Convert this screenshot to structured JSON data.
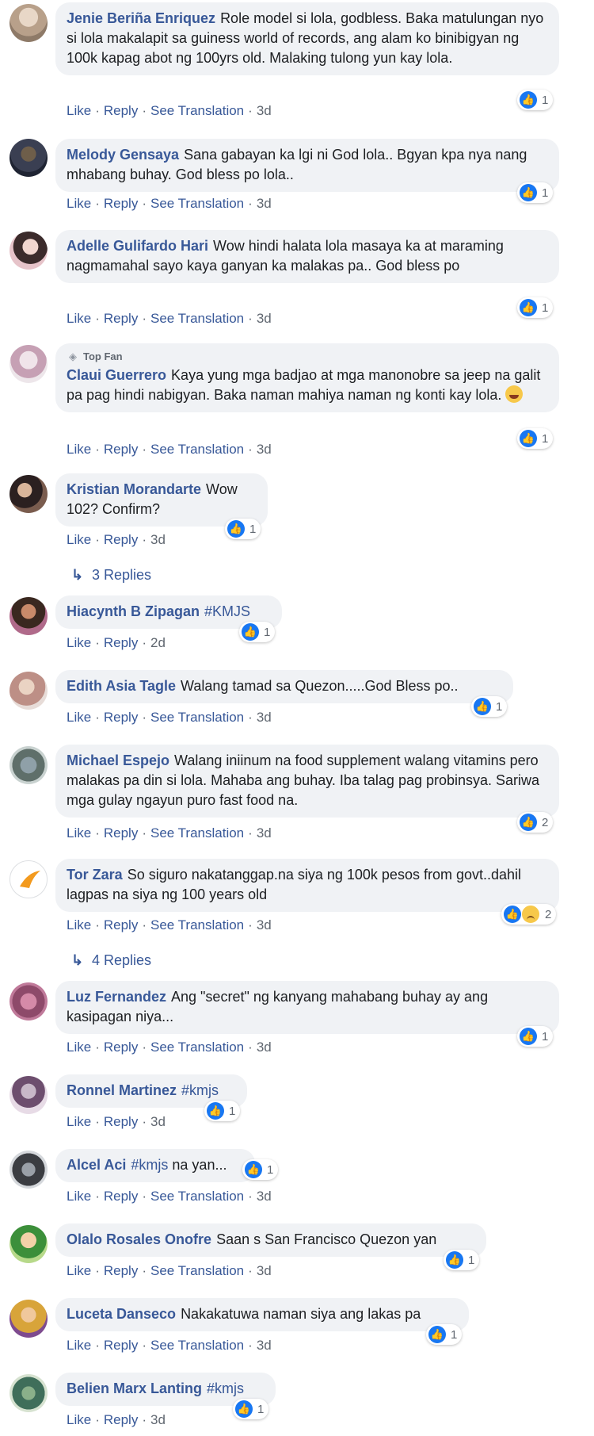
{
  "colors": {
    "name": "#385898",
    "bubble": "#f0f2f5",
    "like_blue": "#1877f2",
    "meta": "#606770"
  },
  "actions": {
    "like": "Like",
    "reply": "Reply",
    "translate": "See Translation",
    "sep": "·"
  },
  "badges": {
    "top_fan": "Top Fan"
  },
  "comments": [
    {
      "name": "Jenie Beriña Enriquez",
      "text": "Role model si lola, godbless. Baka matulungan nyo si lola makalapit sa guiness world of records, ang alam ko binibigyan ng 100k kapag abot ng 100yrs old. Malaking tulong yun kay lola.",
      "time": "3d",
      "reactions": "1"
    },
    {
      "name": "Melody Gensaya",
      "text": "Sana gabayan ka lgi ni God lola.. Bgyan kpa nya nang mhabang buhay. God bless po lola..",
      "time": "3d",
      "reactions": "1"
    },
    {
      "name": "Adelle Gulifardo Hari",
      "text": "Wow hindi halata lola masaya ka at maraming nagmamahal sayo kaya ganyan ka malakas pa.. God bless po",
      "time": "3d",
      "reactions": "1"
    },
    {
      "name": "Claui Guerrero",
      "text": "Kaya yung mga badjao at mga manonobre sa jeep na galit pa pag hindi nabigyan. Baka naman mahiya naman ng konti kay lola.",
      "time": "3d",
      "reactions": "1"
    },
    {
      "name": "Kristian Morandarte",
      "text": "Wow 102? Confirm?",
      "time": "3d",
      "reactions": "1",
      "replies": "3 Replies"
    },
    {
      "name": "Hiacynth B Zipagan",
      "text": "#KMJS",
      "time": "2d",
      "reactions": "1"
    },
    {
      "name": "Edith Asia Tagle",
      "text": "Walang tamad sa Quezon.....God Bless po..",
      "time": "3d",
      "reactions": "1"
    },
    {
      "name": "Michael Espejo",
      "text": "Walang iniinum na food supplement walang vitamins pero malakas pa din si lola. Mahaba ang buhay. Iba talag pag probinsya. Sariwa mga gulay ngayun puro fast food na.",
      "time": "3d",
      "reactions": "2"
    },
    {
      "name": "Tor Zara",
      "text": "So siguro nakatanggap.na siya ng 100k pesos from govt..dahil lagpas na siya ng 100 years old",
      "time": "3d",
      "reactions": "2",
      "replies": "4 Replies"
    },
    {
      "name": "Luz Fernandez",
      "text": "Ang \"secret\" ng kanyang mahabang buhay ay ang kasipagan niya...",
      "time": "3d",
      "reactions": "1"
    },
    {
      "name": "Ronnel Martinez",
      "text": "#kmjs",
      "time": "3d",
      "reactions": "1"
    },
    {
      "name": "Alcel Aci",
      "text_tag": "#kmjs",
      "text": "na yan...",
      "time": "3d",
      "reactions": "1"
    },
    {
      "name": "Olalo Rosales Onofre",
      "text": "Saan s San Francisco Quezon yan",
      "time": "3d",
      "reactions": "1"
    },
    {
      "name": "Luceta Danseco",
      "text": "Nakakatuwa naman siya ang lakas pa",
      "time": "3d",
      "reactions": "1"
    },
    {
      "name": "Belien Marx Lanting",
      "text": "#kmjs",
      "time": "3d",
      "reactions": "1"
    }
  ]
}
